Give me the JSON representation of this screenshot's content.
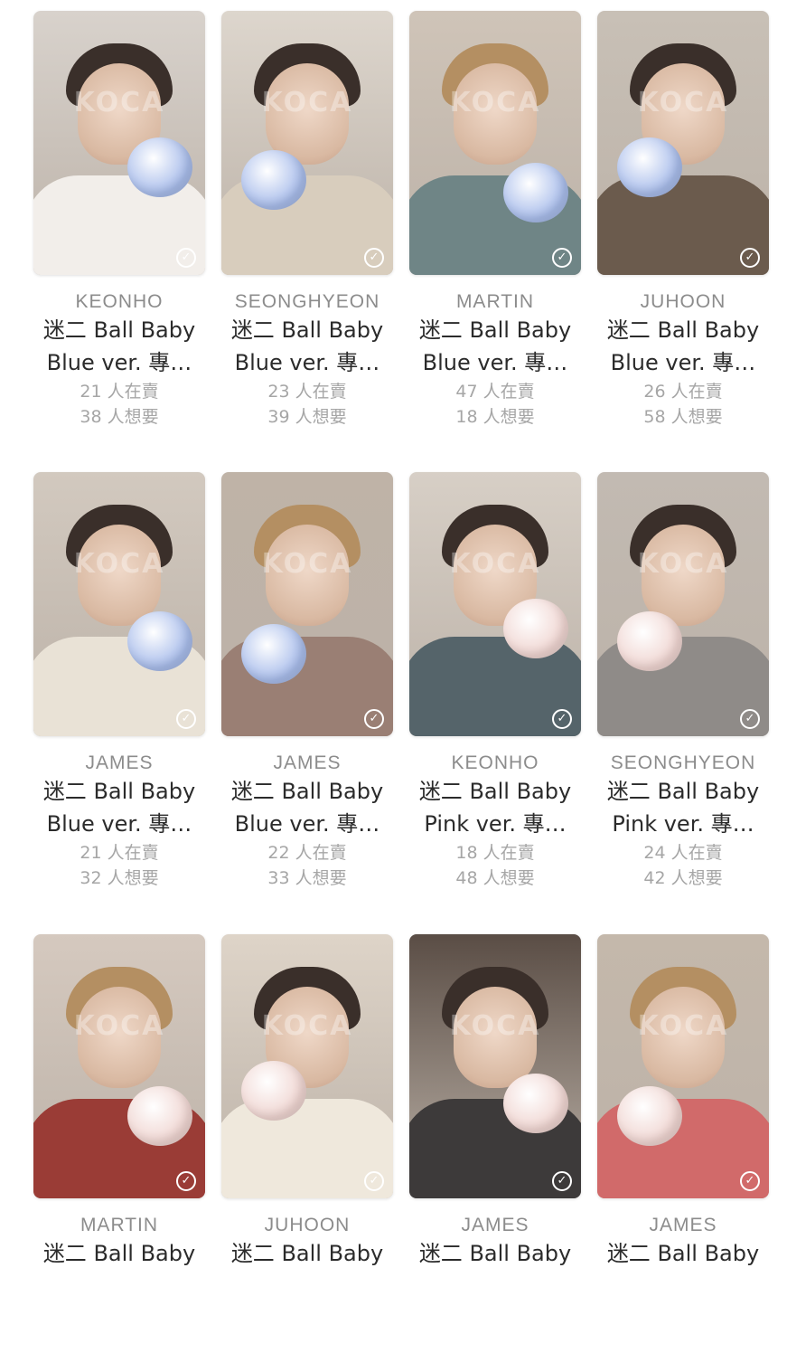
{
  "cards": [
    {
      "member": "KEONHO",
      "title_line1": "迷二 Ball Baby",
      "title_line2": "Blue ver. 專…",
      "selling": "21 人在賣",
      "wanting": "38 人想要",
      "watermark": "KOCA",
      "plush_color": "#a9bdeb",
      "bg": "#d8d2cc",
      "top_color": "#f2eeea"
    },
    {
      "member": "SEONGHYEON",
      "title_line1": "迷二 Ball Baby",
      "title_line2": "Blue ver. 專…",
      "selling": "23 人在賣",
      "wanting": "39 人想要",
      "watermark": "KOCA",
      "plush_color": "#a9bdeb",
      "bg": "#ddd6cd",
      "top_color": "#d8cdbd"
    },
    {
      "member": "MARTIN",
      "title_line1": "迷二 Ball Baby",
      "title_line2": "Blue ver. 專…",
      "selling": "47 人在賣",
      "wanting": "18 人想要",
      "watermark": "KOCA",
      "plush_color": "#a9bdeb",
      "bg": "#cfc4b8",
      "top_color": "#6f8586"
    },
    {
      "member": "JUHOON",
      "title_line1": "迷二 Ball Baby",
      "title_line2": "Blue ver. 專…",
      "selling": "26 人在賣",
      "wanting": "58 人想要",
      "watermark": "KOCA",
      "plush_color": "#a9bdeb",
      "bg": "#c8c0b6",
      "top_color": "#6b5b4d"
    },
    {
      "member": "JAMES",
      "title_line1": "迷二 Ball Baby",
      "title_line2": "Blue ver. 專…",
      "selling": "21 人在賣",
      "wanting": "32 人想要",
      "watermark": "KOCA",
      "plush_color": "#a9bdeb",
      "bg": "#d2c9bf",
      "top_color": "#e9e2d6"
    },
    {
      "member": "JAMES",
      "title_line1": "迷二 Ball Baby",
      "title_line2": "Blue ver. 專…",
      "selling": "22 人在賣",
      "wanting": "33 人想要",
      "watermark": "KOCA",
      "plush_color": "#a9bdeb",
      "bg": "#bfb3a7",
      "top_color": "#9a7f74"
    },
    {
      "member": "KEONHO",
      "title_line1": "迷二 Ball Baby",
      "title_line2": "Pink ver. 專…",
      "selling": "18 人在賣",
      "wanting": "48 人想要",
      "watermark": "KOCA",
      "plush_color": "#f0d6d2",
      "bg": "#d7cfc6",
      "top_color": "#55646a"
    },
    {
      "member": "SEONGHYEON",
      "title_line1": "迷二 Ball Baby",
      "title_line2": "Pink ver. 專…",
      "selling": "24 人在賣",
      "wanting": "42 人想要",
      "watermark": "KOCA",
      "plush_color": "#f0d6d2",
      "bg": "#c2bab2",
      "top_color": "#8f8b88"
    },
    {
      "member": "MARTIN",
      "title_line1": "迷二 Ball Baby",
      "title_line2": "",
      "selling": "",
      "wanting": "",
      "watermark": "KOCA",
      "plush_color": "#f0d6d2",
      "bg": "#d5c9bf",
      "top_color": "#9a3c36"
    },
    {
      "member": "JUHOON",
      "title_line1": "迷二 Ball Baby",
      "title_line2": "",
      "selling": "",
      "wanting": "",
      "watermark": "KOCA",
      "plush_color": "#f0d6d2",
      "bg": "#ded4c8",
      "top_color": "#efe8dc"
    },
    {
      "member": "JAMES",
      "title_line1": "迷二 Ball Baby",
      "title_line2": "",
      "selling": "",
      "wanting": "",
      "watermark": "KOCA",
      "plush_color": "#f0d6d2",
      "bg": "#5a4d45",
      "top_color": "#3d3a3a"
    },
    {
      "member": "JAMES",
      "title_line1": "迷二 Ball Baby",
      "title_line2": "",
      "selling": "",
      "wanting": "",
      "watermark": "KOCA",
      "plush_color": "#f0d6d2",
      "bg": "#c4b8ab",
      "top_color": "#d16a6a"
    }
  ]
}
